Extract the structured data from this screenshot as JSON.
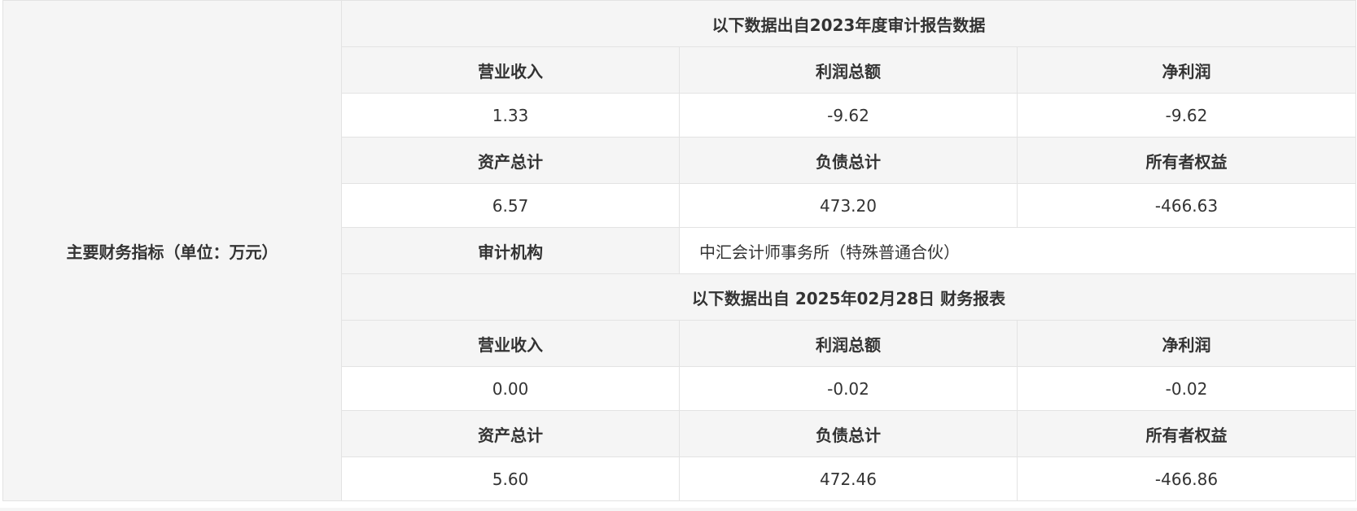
{
  "side_label": "主要财务指标（单位：万元）",
  "sections": [
    {
      "title": "以下数据出自2023年度审计报告数据",
      "row1_headers": [
        "营业收入",
        "利润总额",
        "净利润"
      ],
      "row1_values": [
        "1.33",
        "-9.62",
        "-9.62"
      ],
      "row2_headers": [
        "资产总计",
        "负债总计",
        "所有者权益"
      ],
      "row2_values": [
        "6.57",
        "473.20",
        "-466.63"
      ],
      "audit_label": "审计机构",
      "audit_value": "中汇会计师事务所（特殊普通合伙）"
    },
    {
      "title": "以下数据出自 2025年02月28日 财务报表",
      "row1_headers": [
        "营业收入",
        "利润总额",
        "净利润"
      ],
      "row1_values": [
        "0.00",
        "-0.02",
        "-0.02"
      ],
      "row2_headers": [
        "资产总计",
        "负债总计",
        "所有者权益"
      ],
      "row2_values": [
        "5.60",
        "472.46",
        "-466.86"
      ]
    }
  ]
}
